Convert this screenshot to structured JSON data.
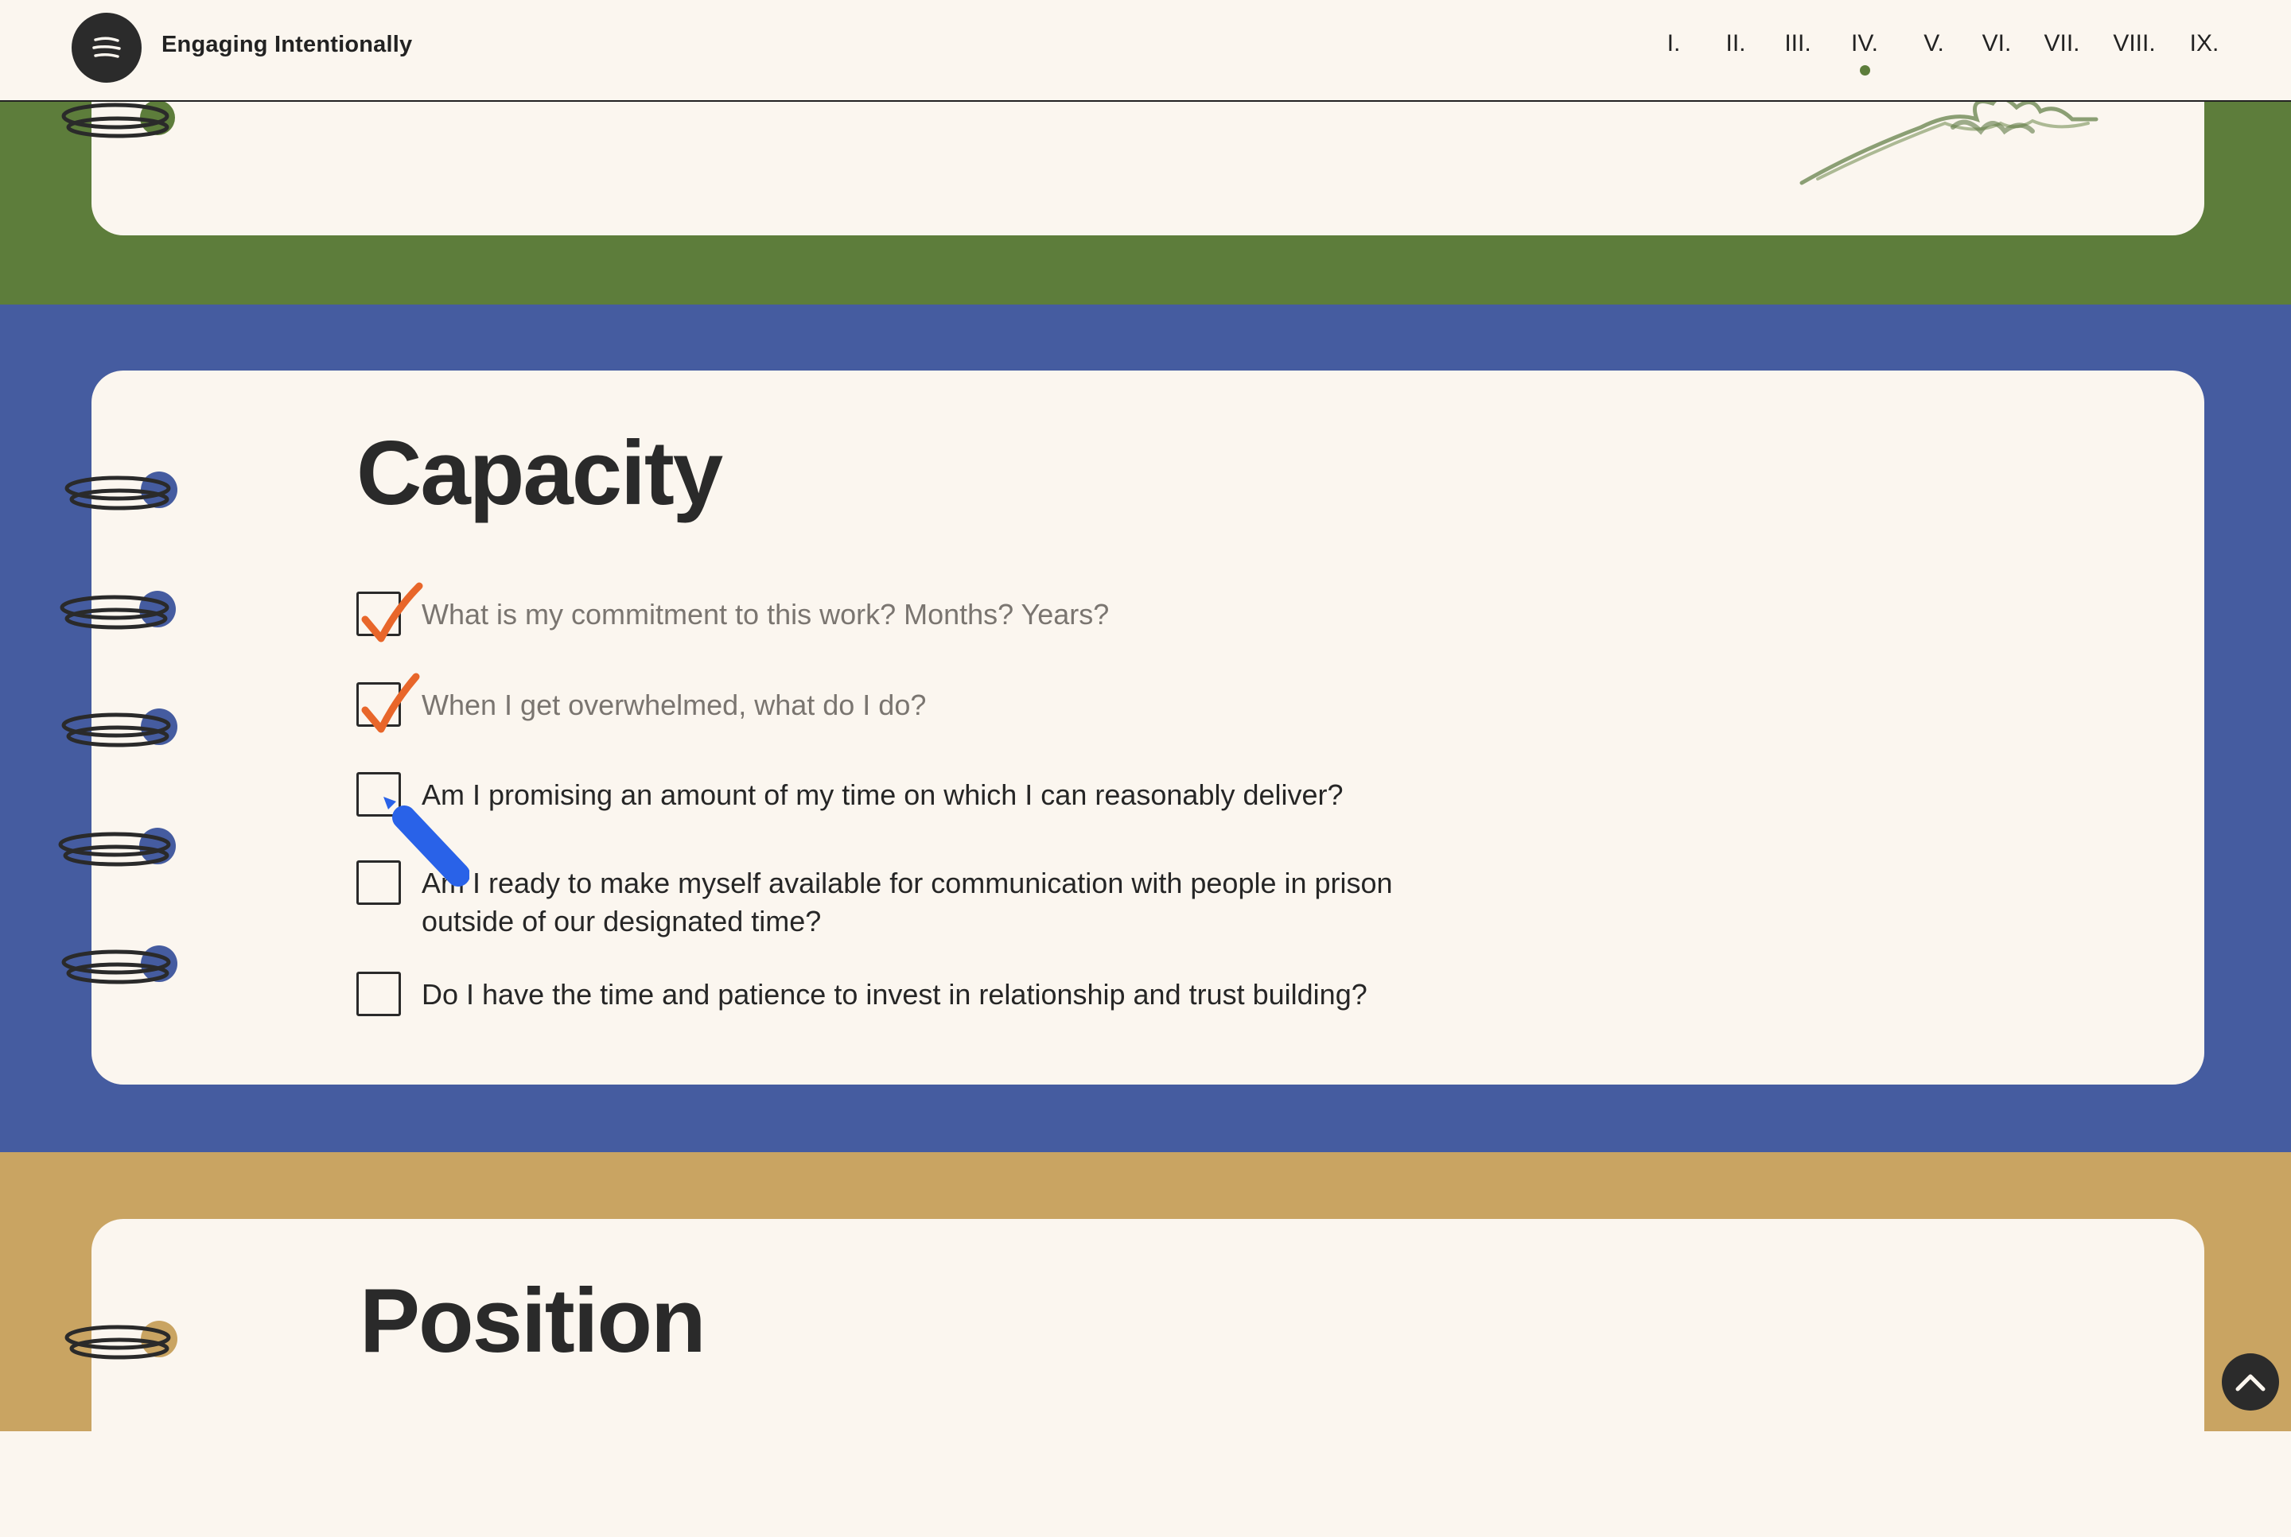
{
  "header": {
    "title": "Engaging Intentionally",
    "menu_icon": "menu-icon",
    "nav": [
      "I.",
      "II.",
      "III.",
      "IV.",
      "V.",
      "VI.",
      "VII.",
      "VIII.",
      "IX."
    ],
    "active_nav": "IV."
  },
  "colors": {
    "green": "#5d7d3b",
    "blue": "#455ca0",
    "gold": "#c9a462",
    "paper": "#fbf6ef",
    "check": "#e8662a",
    "cursor": "#2962e8"
  },
  "capacity": {
    "title": "Capacity",
    "items": [
      {
        "text": "What is my commitment to this work? Months? Years?",
        "checked": true
      },
      {
        "text": "When I get overwhelmed, what do I do?",
        "checked": true
      },
      {
        "text": "Am I promising an amount of my time on which I can reasonably deliver?",
        "checked": false
      },
      {
        "text": "Am I ready to make myself available for communication with people in prison outside of our designated time?",
        "checked": false
      },
      {
        "text": "Do I have the time and patience to invest in relationship and trust building?",
        "checked": false
      }
    ]
  },
  "position": {
    "title": "Position"
  },
  "back_to_top_icon": "chevron-up-icon"
}
